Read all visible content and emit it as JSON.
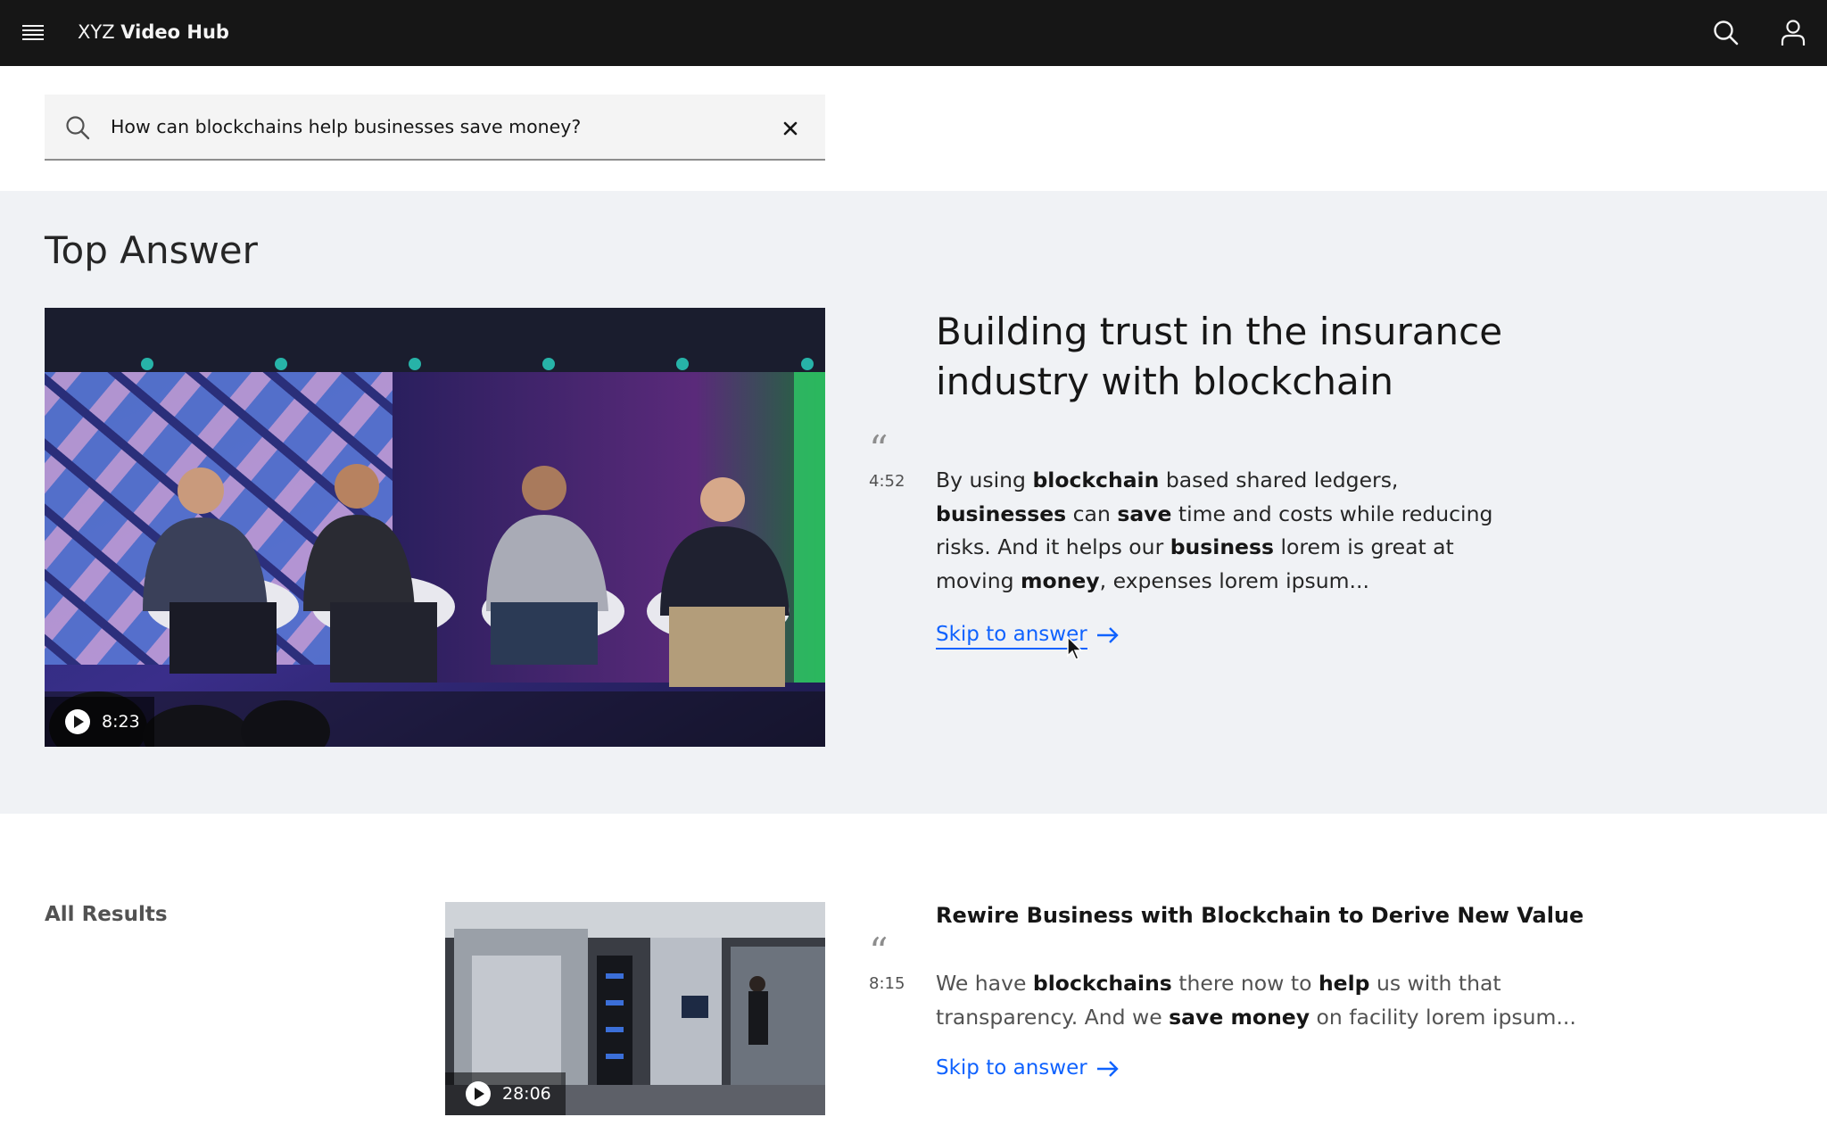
{
  "header": {
    "brand_prefix": "XYZ",
    "brand_name": "Video Hub",
    "icons": {
      "menu": "menu-icon",
      "search": "search-icon",
      "user": "user-icon"
    }
  },
  "search": {
    "value": "How can blockchains help businesses save money?",
    "icons": {
      "search": "search-icon",
      "clear": "close-icon"
    }
  },
  "top_answer": {
    "section_title": "Top Answer",
    "video_duration": "8:23",
    "title": "Building trust in the insurance industry with blockchain",
    "timestamp": "4:52",
    "excerpt": {
      "t1": "By using ",
      "b1": "blockchain",
      "t2": " based shared ledgers, ",
      "b2": "businesses",
      "t3": " can ",
      "b3": "save",
      "t4": " time and costs while reducing risks. And it helps our ",
      "b4": "business",
      "t5": " lorem is great at moving ",
      "b5": "money",
      "t6": ", expenses lorem ipsum..."
    },
    "skip_label": "Skip to answer"
  },
  "all_results": {
    "heading": "All Results",
    "items": [
      {
        "video_duration": "28:06",
        "title": "Rewire Business with Blockchain to Derive New Value",
        "timestamp": "8:15",
        "excerpt": {
          "t1": "We have ",
          "b1": "blockchains",
          "t2": " there now to ",
          "b2": "help",
          "t3": " us with that transparency. And we ",
          "b3": "save money",
          "t4": " on facility lorem ipsum..."
        },
        "skip_label": "Skip to answer"
      }
    ]
  },
  "colors": {
    "header_bg": "#161616",
    "band_bg": "#f0f2f5",
    "link": "#0f62fe",
    "search_bg": "#f4f4f4"
  }
}
